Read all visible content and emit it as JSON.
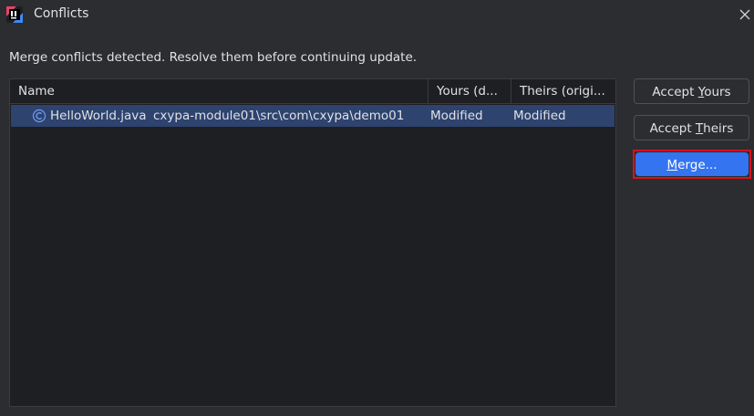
{
  "window": {
    "title": "Conflicts"
  },
  "message": "Merge conflicts detected. Resolve them before continuing update.",
  "table": {
    "columns": [
      "Name",
      "Yours (d...",
      "Theirs (origi..."
    ],
    "rows": [
      {
        "file": "HelloWorld.java",
        "path": "cxypa-module01\\src\\com\\cxypa\\demo01",
        "yours": "Modified",
        "theirs": "Modified",
        "icon": "java-class-icon"
      }
    ]
  },
  "buttons": {
    "accept_yours": {
      "before": "Accept ",
      "mnemonic": "Y",
      "after": "ours"
    },
    "accept_theirs": {
      "before": "Accept ",
      "mnemonic": "T",
      "after": "heirs"
    },
    "merge": {
      "before": "",
      "mnemonic": "M",
      "after": "erge..."
    }
  },
  "colors": {
    "background": "#2b2d30",
    "table_background": "#1e1f22",
    "selection": "#2e436e",
    "accent": "#3574f0",
    "highlight_frame": "#d9121b"
  }
}
